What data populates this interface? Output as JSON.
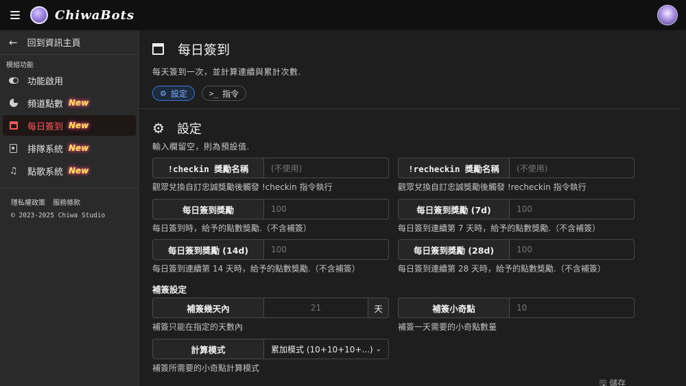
{
  "topbar": {
    "brand": "ChiwaBots"
  },
  "sidebar": {
    "back_label": "回到資訊主頁",
    "section_title": "模組功能",
    "items": [
      {
        "label": "功能啟用",
        "new": ""
      },
      {
        "label": "頻道點數",
        "new": "New"
      },
      {
        "label": "每日簽到",
        "new": "New"
      },
      {
        "label": "排隊系統",
        "new": "New"
      },
      {
        "label": "點歌系統",
        "new": "New"
      }
    ],
    "links": [
      "隱私權政策",
      "服務條款"
    ],
    "copyright": "© 2023-2025 Chiwa Studio"
  },
  "page": {
    "title": "每日簽到",
    "description": "每天簽到一次，並計算連續與累計次數.",
    "tabs": [
      "設定",
      "指令"
    ]
  },
  "settings": {
    "title": "設定",
    "hint": "輸入欄留空，則為預設值.",
    "fields": {
      "checkin_reward": {
        "label": "!checkin 獎勵名稱",
        "placeholder": "(不使用)",
        "help": "觀眾兌換自訂忠誠獎勵後觸發 !checkin 指令執行"
      },
      "recheckin_reward": {
        "label": "!recheckin 獎勵名稱",
        "placeholder": "(不使用)",
        "help": "觀眾兌換自訂忠誠獎勵後觸發 !recheckin 指令執行"
      },
      "daily_reward": {
        "label": "每日簽到獎勵",
        "placeholder": "100",
        "help": "每日簽到時，給予的點數獎勵.（不含補簽）"
      },
      "reward_7d": {
        "label": "每日簽到獎勵 (7d)",
        "placeholder": "100",
        "help": "每日簽到連續第 7 天時，給予的點數獎勵.（不含補簽）"
      },
      "reward_14d": {
        "label": "每日簽到獎勵 (14d)",
        "placeholder": "100",
        "help": "每日簽到連續第 14 天時，給予的點數獎勵.（不含補簽）"
      },
      "reward_28d": {
        "label": "每日簽到獎勵 (28d)",
        "placeholder": "100",
        "help": "每日簽到連續第 28 天時，給予的點數獎勵.（不含補簽）"
      }
    },
    "makeup_title": "補簽設定",
    "makeup": {
      "days": {
        "label": "補簽幾天內",
        "value": "21",
        "suffix": "天",
        "help": "補簽只能在指定的天數內"
      },
      "points": {
        "label": "補簽小奇點",
        "placeholder": "10",
        "help": "補簽一天需要的小奇點數量"
      },
      "mode": {
        "label": "計算模式",
        "value": "累加模式 (10+10+10+...)",
        "help": "補簽所需要的小奇點計算模式"
      }
    },
    "save_label": "儲存"
  }
}
